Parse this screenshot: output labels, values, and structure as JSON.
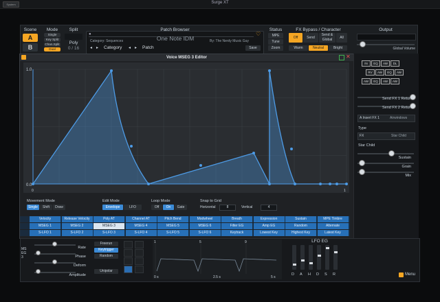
{
  "window": {
    "title": "Surge XT",
    "system_label": "System"
  },
  "header": {
    "scene_label": "Scene",
    "scene_a": "A",
    "scene_b": "B",
    "mode_label": "Mode",
    "modes": [
      "Single",
      "Key Split",
      "Chan.Split",
      "Dual"
    ],
    "mode_selected": "Dual",
    "split_label": "Split",
    "poly_label": "Poly",
    "poly_value": "0 / 16",
    "patch_browser_label": "Patch Browser",
    "category_text": "Category: Sequences",
    "patch_name": "One Note IDM",
    "author_text": "By: The Nerdy Music Guy",
    "category_nav": "Category",
    "patch_nav": "Patch",
    "save_label": "Save",
    "status_label": "Status",
    "status_buttons": [
      "MPE",
      "Tune",
      "Zoom"
    ],
    "fx_label": "FX Bypass / Character",
    "fx_buttons": [
      "Off",
      "Send",
      "Send & Global",
      "All"
    ],
    "character_buttons": [
      "Warm",
      "Neutral",
      "Bright"
    ],
    "character_selected": "Neutral",
    "output_label": "Output",
    "global_volume_label": "Global Volume"
  },
  "editor": {
    "title": "Voice MSEG 3 Editor",
    "y_axis": [
      "1.0",
      "0.0"
    ],
    "x_axis": [
      "0",
      "1"
    ],
    "movement_label": "Movement Mode",
    "movement_modes": [
      "Single",
      "Shift",
      "Draw"
    ],
    "movement_selected": "Single",
    "edit_label": "Edit Mode",
    "edit_modes": [
      "Envelope",
      "LFO"
    ],
    "edit_selected": "Envelope",
    "loop_label": "Loop Mode",
    "loop_modes": [
      "Off",
      "On",
      "Gate"
    ],
    "loop_selected": "On",
    "snap_label": "Snap to Grid",
    "snap_horizontal_label": "Horizontal",
    "snap_horizontal": "8",
    "snap_vertical_label": "Vertical",
    "snap_vertical": "4"
  },
  "right_panel": {
    "send1": "Send FX 1 Return",
    "send2": "Send FX 2 Return",
    "insert_fx": "A Insert FX 1",
    "insert_fx_preset": "Airwindows",
    "type_label": "Type",
    "type_value": "FX",
    "type_preset": "Star Child",
    "fx_name": "Star Child",
    "params": [
      "Sustain",
      "Grain",
      "Mix"
    ],
    "routing": [
      "IN",
      "EQ",
      "AW",
      "DL",
      "RV",
      "AW",
      "EQ",
      "AW",
      "AW",
      "EQ",
      "AW",
      "AW"
    ]
  },
  "modulation": {
    "row1": [
      "Velocity",
      "Release Velocity",
      "Poly AT",
      "Channel AT",
      "Pitch Bend",
      "Modwheel",
      "Breath",
      "Expression",
      "Sustain",
      "MPE Timbre"
    ],
    "row2": [
      "MSEG 1",
      "MSEG 2",
      "MSEG 3",
      "MSEG 4",
      "MSEG 5",
      "MSEG 6",
      "Filter EG",
      "Amp EG",
      "Random",
      "Alternate"
    ],
    "row3": [
      "S-LFO 1",
      "S-LFO 2",
      "S-LFO 3",
      "S-LFO 4",
      "S-LFO 5",
      "S-LFO 6",
      "Keytrack",
      "Lowest Key",
      "Highest Key",
      "Latest Key"
    ]
  },
  "bottom": {
    "side_label": "MSEG 3",
    "params": [
      "Rate",
      "Phase",
      "Deform",
      "Amplitude"
    ],
    "trigger_modes": [
      "Freerun",
      "Keytrigger",
      "Random"
    ],
    "trigger_selected": "Keytrigger",
    "unipolar_label": "Unipolar",
    "preview_ticks": [
      "1",
      "5",
      "9"
    ],
    "preview_bottom": [
      "0 s",
      "2.5 s",
      "5 s"
    ],
    "eg_title": "LFO EG",
    "eg_labels": [
      "D",
      "A",
      "H",
      "D",
      "S",
      "R"
    ],
    "menu_label": "Menu"
  },
  "colors": {
    "accent": "#f5a623",
    "mod_blue": "#2770b8",
    "curve": "#4d9be6"
  }
}
